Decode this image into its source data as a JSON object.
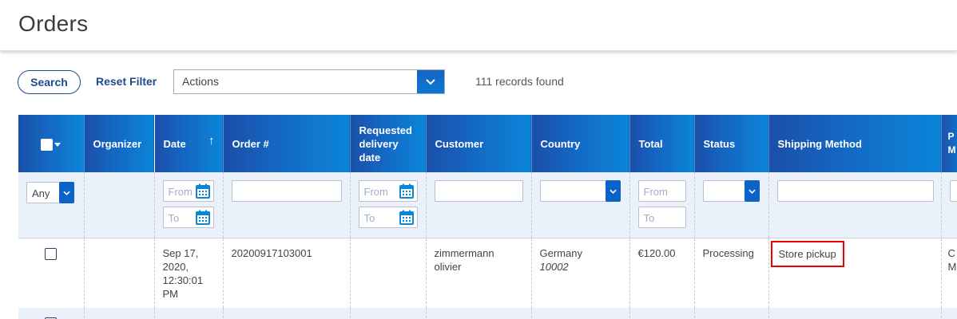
{
  "header": {
    "title": "Orders"
  },
  "toolbar": {
    "search_label": "Search",
    "reset_label": "Reset Filter",
    "actions_value": "Actions",
    "records_text": "111 records found"
  },
  "table": {
    "columns": {
      "organizer": "Organizer",
      "date": "Date",
      "date_sort": "↑",
      "order": "Order #",
      "requested": "Requested delivery date",
      "customer": "Customer",
      "country": "Country",
      "total": "Total",
      "status": "Status",
      "shipping": "Shipping Method",
      "payment_partial": "P M"
    },
    "filters": {
      "any_value": "Any",
      "from_placeholder": "From",
      "to_placeholder": "To"
    },
    "rows": [
      {
        "date": "Sep 17, 2020, 12:30:01 PM",
        "order": "20200917103001",
        "customer": "zimmermann olivier",
        "country": "Germany",
        "postal": "10002",
        "total": "€120.00",
        "status": "Processing",
        "shipping": "Store pickup",
        "payment_partial": "C M"
      }
    ]
  },
  "colors": {
    "header_start": "#1b4fa8",
    "header_end": "#0b85d8",
    "highlight": "#e00000",
    "link": "#1e4a8c"
  }
}
